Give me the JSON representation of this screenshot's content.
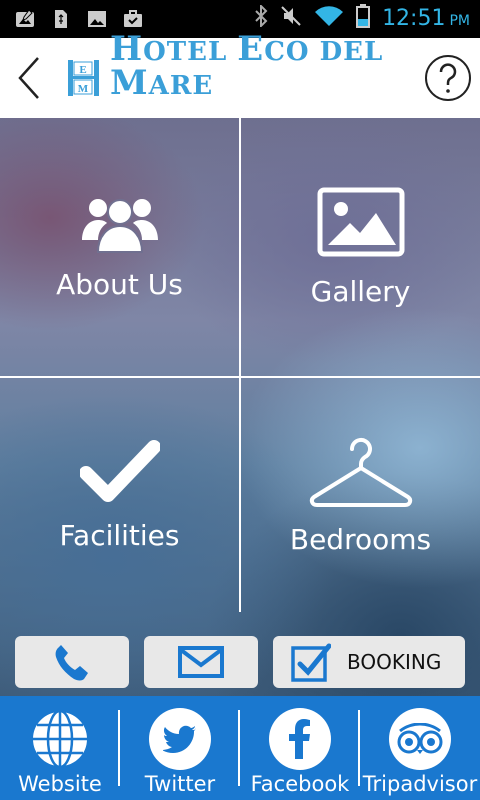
{
  "status_bar": {
    "time": "12:51",
    "ampm": "PM",
    "icons": [
      "photo-edit-icon",
      "usb-file-icon",
      "image-icon",
      "briefcase-check-icon",
      "bluetooth-icon",
      "vibrate-off-icon",
      "wifi-icon",
      "battery-icon"
    ],
    "accent_color": "#33b5e5"
  },
  "header": {
    "logo_mark": "HEM",
    "logo_words": [
      {
        "cap": "H",
        "rest": "OTEL"
      },
      {
        "cap": "E",
        "rest": "CO DEL"
      },
      {
        "cap": "M",
        "rest": "ARE"
      }
    ],
    "back_icon": "chevron-left-icon",
    "help_icon": "question-circle-icon",
    "brand_color": "#3b9fd8"
  },
  "tiles": [
    {
      "label": "About Us",
      "icon": "users-icon"
    },
    {
      "label": "Gallery",
      "icon": "image-icon"
    },
    {
      "label": "Facilities",
      "icon": "checkmark-icon"
    },
    {
      "label": "Bedrooms",
      "icon": "hanger-icon"
    }
  ],
  "actions": {
    "call_icon": "phone-icon",
    "mail_icon": "envelope-icon",
    "booking_icon": "checkbox-icon",
    "booking_label": "BOOKING",
    "icon_color": "#1a78cf"
  },
  "bottom_nav": [
    {
      "label": "Website",
      "icon": "globe-icon"
    },
    {
      "label": "Twitter",
      "icon": "twitter-icon"
    },
    {
      "label": "Facebook",
      "icon": "facebook-icon"
    },
    {
      "label": "Tripadvisor",
      "icon": "tripadvisor-icon"
    }
  ],
  "colors": {
    "bottom_bar": "#1a78cf",
    "button_bg": "#e8e8e8"
  }
}
